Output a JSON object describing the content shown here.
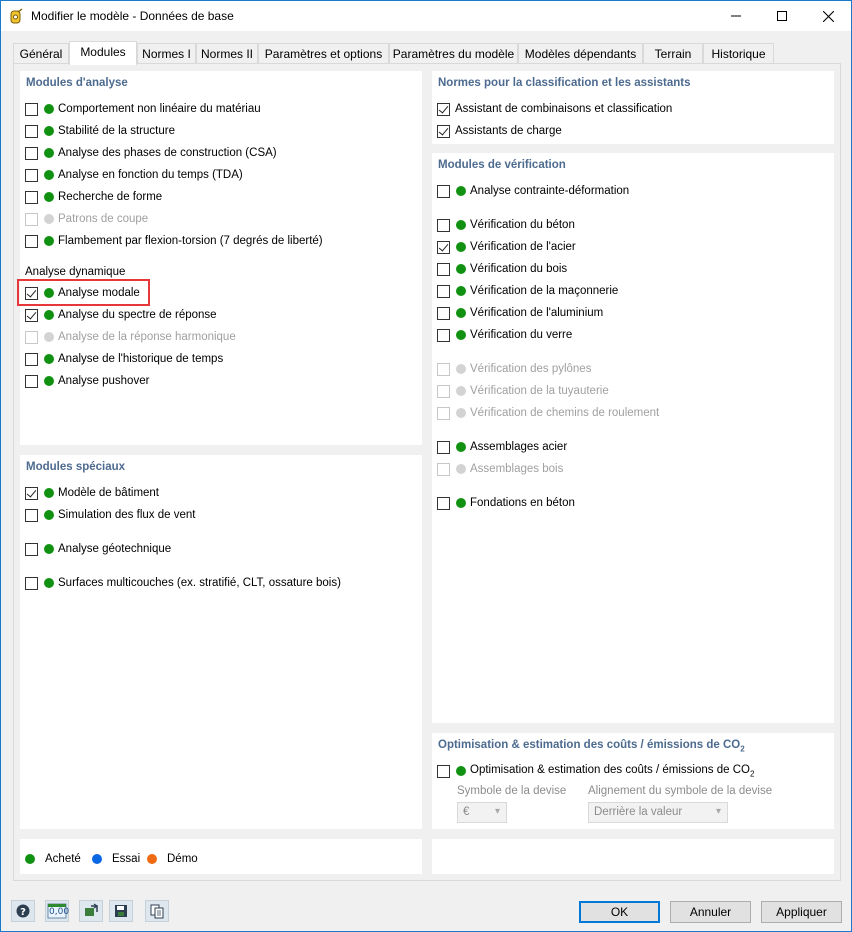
{
  "window": {
    "title": "Modifier le modèle - Données de base"
  },
  "tabs": [
    {
      "label": "Général"
    },
    {
      "label": "Modules",
      "active": true
    },
    {
      "label": "Normes I"
    },
    {
      "label": "Normes II"
    },
    {
      "label": "Paramètres et options"
    },
    {
      "label": "Paramètres du modèle"
    },
    {
      "label": "Modèles dépendants"
    },
    {
      "label": "Terrain"
    },
    {
      "label": "Historique"
    }
  ],
  "analysis_modules": {
    "title": "Modules d'analyse",
    "items": [
      {
        "label": "Comportement non linéaire du matériau",
        "checked": false,
        "enabled": true
      },
      {
        "label": "Stabilité de la structure",
        "checked": false,
        "enabled": true
      },
      {
        "label": "Analyse des phases de construction (CSA)",
        "checked": false,
        "enabled": true
      },
      {
        "label": "Analyse en fonction du temps (TDA)",
        "checked": false,
        "enabled": true
      },
      {
        "label": "Recherche de forme",
        "checked": false,
        "enabled": true
      },
      {
        "label": "Patrons de coupe",
        "checked": false,
        "enabled": false
      },
      {
        "label": "Flambement par flexion-torsion (7 degrés de liberté)",
        "checked": false,
        "enabled": true
      }
    ],
    "dynamic_label": "Analyse dynamique",
    "dynamic_items": [
      {
        "label": "Analyse modale",
        "checked": true,
        "enabled": true
      },
      {
        "label": "Analyse du spectre de réponse",
        "checked": true,
        "enabled": true
      },
      {
        "label": "Analyse de la réponse harmonique",
        "checked": false,
        "enabled": false
      },
      {
        "label": "Analyse de l'historique de temps",
        "checked": false,
        "enabled": true
      },
      {
        "label": "Analyse pushover",
        "checked": false,
        "enabled": true
      }
    ]
  },
  "special_modules": {
    "title": "Modules spéciaux",
    "items": [
      {
        "label": "Modèle de bâtiment",
        "checked": true,
        "enabled": true
      },
      {
        "label": "Simulation des flux de vent",
        "checked": false,
        "enabled": true
      },
      {
        "label": "Analyse géotechnique",
        "checked": false,
        "enabled": true
      },
      {
        "label": "Surfaces multicouches (ex. stratifié, CLT, ossature bois)",
        "checked": false,
        "enabled": true
      }
    ]
  },
  "standards": {
    "title": "Normes pour la classification et les assistants",
    "items": [
      {
        "label": "Assistant de combinaisons et classification",
        "checked": true
      },
      {
        "label": "Assistants de charge",
        "checked": true
      }
    ]
  },
  "design_modules": {
    "title": "Modules de vérification",
    "items": [
      {
        "label": "Analyse contrainte-déformation",
        "checked": false,
        "enabled": true
      },
      {
        "label": "Vérification du béton",
        "checked": false,
        "enabled": true
      },
      {
        "label": "Vérification de l'acier",
        "checked": true,
        "enabled": true
      },
      {
        "label": "Vérification du bois",
        "checked": false,
        "enabled": true
      },
      {
        "label": "Vérification de la maçonnerie",
        "checked": false,
        "enabled": true
      },
      {
        "label": "Vérification de l'aluminium",
        "checked": false,
        "enabled": true
      },
      {
        "label": "Vérification du verre",
        "checked": false,
        "enabled": true
      },
      {
        "label": "Vérification des pylônes",
        "checked": false,
        "enabled": false
      },
      {
        "label": "Vérification de la tuyauterie",
        "checked": false,
        "enabled": false
      },
      {
        "label": "Vérification de chemins de roulement",
        "checked": false,
        "enabled": false
      },
      {
        "label": "Assemblages acier",
        "checked": false,
        "enabled": true
      },
      {
        "label": "Assemblages bois",
        "checked": false,
        "enabled": false
      },
      {
        "label": "Fondations en béton",
        "checked": false,
        "enabled": true
      }
    ]
  },
  "optimization": {
    "title": "Optimisation & estimation des coûts / émissions de CO",
    "title_sub": "2",
    "item_label": "Optimisation & estimation des coûts / émissions de CO",
    "item_sub": "2",
    "checked": false,
    "currency_label": "Symbole de la devise",
    "currency_value": "€",
    "alignment_label": "Alignement du symbole de la devise",
    "alignment_value": "Derrière la valeur"
  },
  "legend": [
    {
      "label": "Acheté",
      "color": "#119111"
    },
    {
      "label": "Essai",
      "color": "#0b67e3"
    },
    {
      "label": "Démo",
      "color": "#f06a13"
    }
  ],
  "buttons": {
    "ok": "OK",
    "cancel": "Annuler",
    "apply": "Appliquer"
  },
  "toolbar_value": "0,00"
}
